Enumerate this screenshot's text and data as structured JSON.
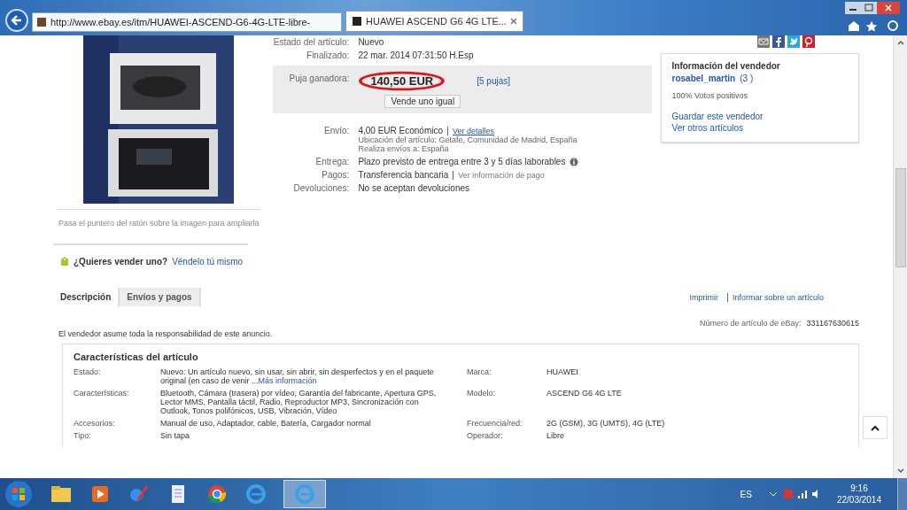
{
  "browser": {
    "address": "http://www.ebay.es/itm/HUAWEI-ASCEND-G6-4G-LTE-libre-",
    "tabs": [
      {
        "title": "HUAWEI ASCEND G6 4G LTE...",
        "selected": true
      }
    ]
  },
  "photo_caption": "Pasa el puntero del ratón sobre la imagen para ampliarla",
  "details": [
    {
      "kind": "text",
      "label": "Estado del artículo:",
      "value": "Nuevo"
    },
    {
      "kind": "text",
      "label": "Finalizado:",
      "value": "22 mar. 2014 07:31:50 H.Esp"
    },
    {
      "kind": "price",
      "label": "Puja ganadora:",
      "value": "140,50 EUR",
      "link": "[5 pujas]",
      "action": "Vende uno igual"
    },
    {
      "kind": "shipping",
      "label": "Envío:",
      "value": "4,00 EUR Económico",
      "link": "Ver detalles",
      "lines": [
        "Ubicación del artículo: Getafe, Comunidad de Madrid, España",
        "Realiza envíos a: España"
      ]
    },
    {
      "kind": "info",
      "label": "Entrega:",
      "value": "Plazo previsto de entrega entre 3 y 5 días laborables"
    },
    {
      "kind": "payment",
      "label": "Pagos:",
      "value": "Transferencia bancaria",
      "link": "Ver información de pago"
    },
    {
      "kind": "text",
      "label": "Devoluciones:",
      "value": "No se aceptan devoluciones"
    }
  ],
  "seller": {
    "title": "Información del vendedor",
    "name": "rosabel_martin",
    "score": "(3 )",
    "feedback": "100% Votos positivos",
    "links": [
      "Guardar este vendedor",
      "Ver otros artículos"
    ]
  },
  "sell_prompt": {
    "text": "¿Quieres vender uno?",
    "link": "Véndelo tú mismo"
  },
  "tabs": [
    {
      "label": "Descripción",
      "selected": true
    },
    {
      "label": "Envíos y pagos",
      "selected": false
    }
  ],
  "links": [
    "Imprimir",
    "Informar sobre un artículo"
  ],
  "item_number": {
    "label": "Número de artículo de eBay:",
    "value": "331167630615"
  },
  "disclaimer": "El vendedor asume toda la responsabilidad de este anuncio.",
  "specifics": {
    "title": "Características del artículo",
    "rows": [
      {
        "cells": [
          {
            "label": "Estado:",
            "value": "Nuevo: Un artículo nuevo, sin usar, sin abrir, sin desperfectos y en el paquete original (en caso de venir ...",
            "link": "Más información"
          },
          {
            "label": "Marca:",
            "value": "HUAWEI"
          }
        ]
      },
      {
        "cells": [
          {
            "label": "Características:",
            "value": "Bluetooth, Cámara (trasera) por vídeo, Garantía del fabricante, Apertura GPS, Lector MMS, Pantalla táctil, Radio, Reproductor MP3, Sincronización con Outlook, Tonos polifónicos, USB, Vibración, Vídeo"
          },
          {
            "label": "Modelo:",
            "value": "ASCEND G6 4G LTE"
          }
        ]
      },
      {
        "cells": [
          {
            "label": "Accesorios:",
            "value": "Manual de uso, Adaptador, cable, Batería, Cargador normal"
          },
          {
            "label": "Frecuencia/red:",
            "value": "2G (GSM), 3G (UMTS), 4G (LTE)"
          }
        ]
      },
      {
        "cells": [
          {
            "label": "Tipo:",
            "value": "Sin tapa"
          },
          {
            "label": "Operador:",
            "value": "Libre"
          }
        ]
      }
    ]
  },
  "taskbar": {
    "language": "ES",
    "time": "9:16",
    "date": "22/03/2014"
  }
}
